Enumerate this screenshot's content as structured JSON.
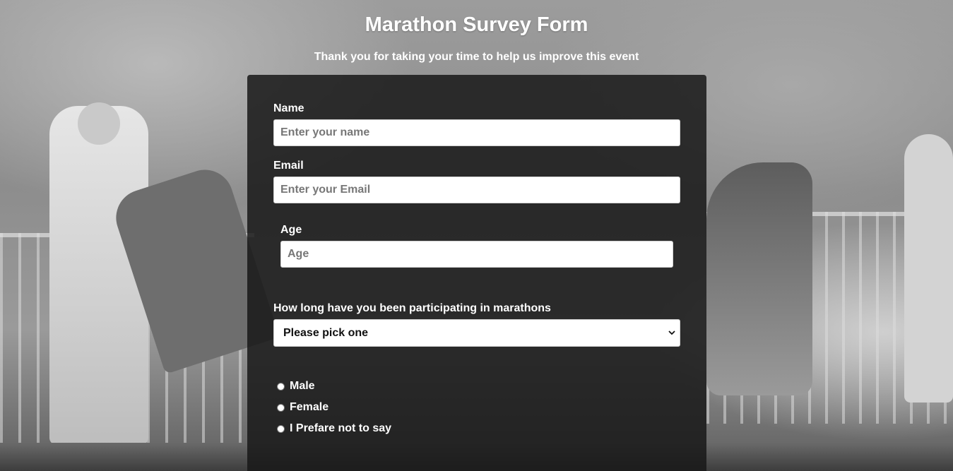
{
  "header": {
    "title": "Marathon Survey Form",
    "subtitle": "Thank you for taking your time to help us improve this event"
  },
  "form": {
    "name": {
      "label": "Name",
      "placeholder": "Enter your name",
      "value": ""
    },
    "email": {
      "label": "Email",
      "placeholder": "Enter your Email",
      "value": ""
    },
    "age": {
      "label": "Age",
      "placeholder": "Age",
      "value": ""
    },
    "experience": {
      "label": "How long have you been participating in marathons",
      "selected": "Please pick one"
    },
    "gender": {
      "options": [
        "Male",
        "Female",
        "I Prefare not to say"
      ],
      "selected": null
    }
  },
  "colors": {
    "card_background": "#181818",
    "text": "#ffffff",
    "input_background": "#ffffff",
    "placeholder": "#777777"
  },
  "icons": {
    "select_arrow": "chevron-down-icon"
  }
}
